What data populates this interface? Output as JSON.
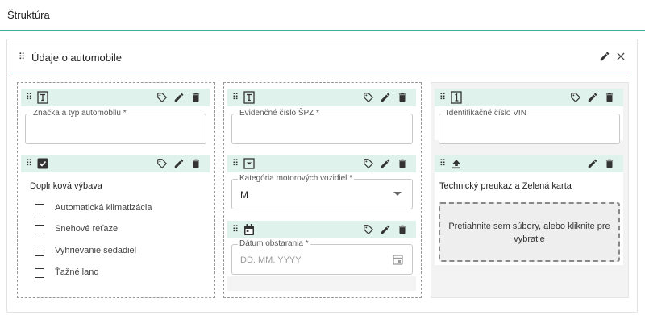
{
  "page": {
    "title": "Štruktúra"
  },
  "section": {
    "title": "Údaje o automobile"
  },
  "fields": {
    "brand": {
      "label": "Značka a typ automobilu *"
    },
    "plate": {
      "label": "Evidenčné číslo ŠPZ *"
    },
    "vin": {
      "label": "Identifikačné číslo VIN"
    },
    "equipment": {
      "label": "Doplnková výbava",
      "options": [
        "Automatická klimatizácia",
        "Snehové reťaze",
        "Vyhrievanie sedadiel",
        "Ťažné lano"
      ]
    },
    "category": {
      "label": "Kategória motorových vozidiel *",
      "value": "M"
    },
    "acquired": {
      "label": "Dátum obstarania *",
      "placeholder": "DD. MM. YYYY"
    },
    "documents": {
      "label": "Technický preukaz a Zelená karta",
      "dropzone_text": "Pretiahnite sem súbory, alebo kliknite pre vybratie"
    }
  },
  "colors": {
    "accent": "#3bb3a3",
    "field_bar": "#dff2ec"
  }
}
